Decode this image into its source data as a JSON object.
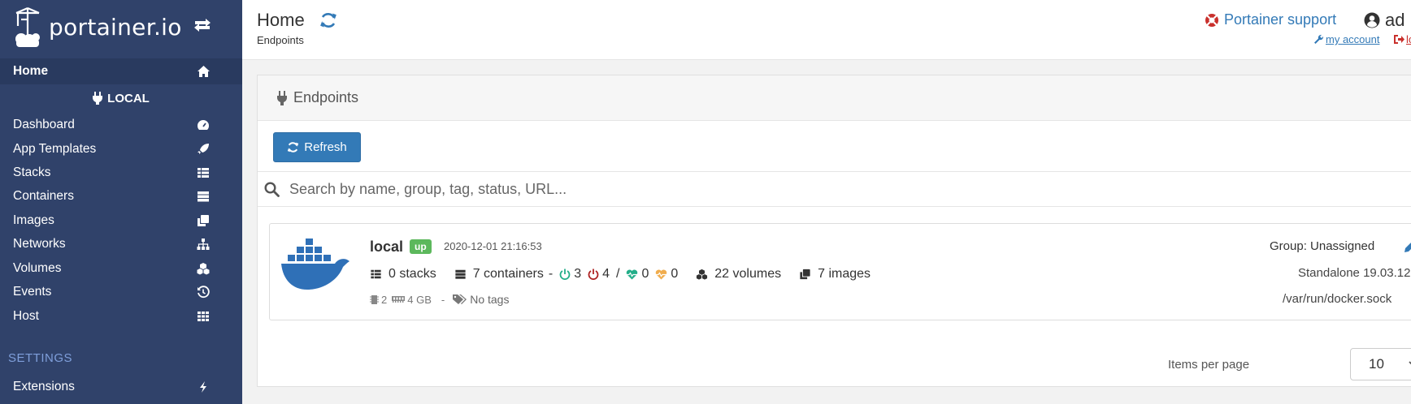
{
  "sidebar": {
    "logo_text": "portainer.io",
    "home_label": "Home",
    "endpoint_header": "LOCAL",
    "items": [
      {
        "label": "Dashboard",
        "icon": "tachometer-icon"
      },
      {
        "label": "App Templates",
        "icon": "rocket-icon"
      },
      {
        "label": "Stacks",
        "icon": "th-list-icon"
      },
      {
        "label": "Containers",
        "icon": "server-icon"
      },
      {
        "label": "Images",
        "icon": "clone-icon"
      },
      {
        "label": "Networks",
        "icon": "sitemap-icon"
      },
      {
        "label": "Volumes",
        "icon": "cubes-icon"
      },
      {
        "label": "Events",
        "icon": "history-icon"
      },
      {
        "label": "Host",
        "icon": "th-icon"
      }
    ],
    "settings_header": "SETTINGS",
    "extensions_label": "Extensions"
  },
  "header": {
    "title": "Home",
    "breadcrumb": "Endpoints",
    "support_label": "Portainer support",
    "user_label": "ad",
    "my_account_label": "my account",
    "logout_label": "lo"
  },
  "panel": {
    "title": "Endpoints",
    "refresh_label": "Refresh",
    "search_placeholder": "Search by name, group, tag, status, URL..."
  },
  "endpoint": {
    "name": "local",
    "status": "up",
    "timestamp": "2020-12-01 21:16:53",
    "stacks": "0 stacks",
    "containers": "7 containers",
    "running": "3",
    "stopped": "4",
    "separator": "/",
    "healthy": "0",
    "unhealthy": "0",
    "volumes": "22 volumes",
    "images": "7 images",
    "cpu": "2",
    "memory": "4 GB",
    "tags": "No tags",
    "group": "Group: Unassigned",
    "platform": "Standalone 19.03.12",
    "url": "/var/run/docker.sock"
  },
  "pagination": {
    "items_per_page_label": "Items per page",
    "items_per_page_value": "10"
  },
  "colors": {
    "sidebar_bg": "#30426a",
    "accent": "#337ab7",
    "up_badge": "#5cb85c",
    "running": "#23ae89",
    "stopped": "#ae2323",
    "docker_blue": "#2f70b7"
  }
}
